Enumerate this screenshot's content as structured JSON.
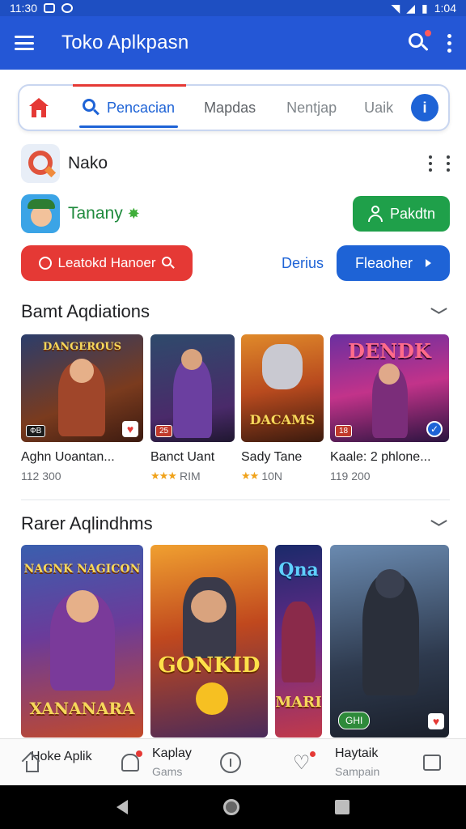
{
  "status_bar": {
    "time_left": "11:30",
    "time_right": "1:04"
  },
  "app_bar": {
    "title": "Toko Aplkpasn"
  },
  "tabs": {
    "active": "Pencacian",
    "t2": "Mapdas",
    "t3": "Nentjap",
    "t4": "Uaik",
    "info_glyph": "i"
  },
  "row_nako": {
    "title": "Nako"
  },
  "row_tanany": {
    "title": "Tanany",
    "button": "Pakdtn"
  },
  "action_row": {
    "red_button": "Leatokd Hanoer",
    "link": "Derius",
    "blue_button": "Fleaoher"
  },
  "section1": {
    "title": "Bamt Aqdiations",
    "cards": [
      {
        "art_text": "DANGEROUS",
        "name": "Aghn Uoantan...",
        "meta": "112 300",
        "badge": "ФВ"
      },
      {
        "art_text": "",
        "name": "Banct Uant",
        "meta": "RIM",
        "badge": "25"
      },
      {
        "art_text": "DACAMS",
        "name": "Sady Tane",
        "meta": "10N",
        "badge": ""
      },
      {
        "art_text": "DENDK",
        "name": "Kaale: 2 phlone...",
        "meta": "119 200",
        "badge": "18"
      }
    ]
  },
  "section2": {
    "title": "Rarer Aqlindhms",
    "cards": [
      {
        "art_top": "NAGNK NAGICON",
        "art_bottom": "XANANARA"
      },
      {
        "art_text": "GONKID"
      },
      {
        "art_top": "Qna",
        "art_bottom": "MARI"
      },
      {
        "badge": "GHI"
      }
    ]
  },
  "bottom_nav": {
    "item1": "Hoke Aplik",
    "item2_label": "Kaplay",
    "item2_sub": "Gams",
    "item4_label": "Haytaik",
    "item4_sub": "Sampain"
  },
  "colors": {
    "primary": "#2457d6",
    "accent_red": "#e53935",
    "accent_green": "#1fa04a"
  }
}
